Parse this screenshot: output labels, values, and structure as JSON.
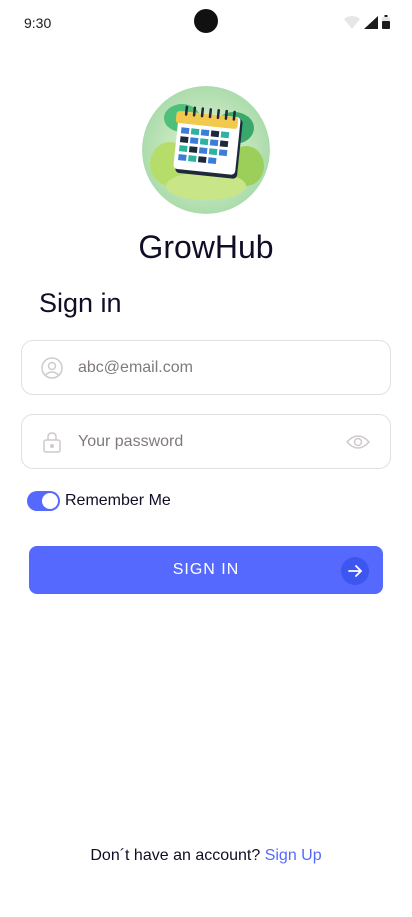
{
  "status_bar": {
    "time": "9:30"
  },
  "app": {
    "name": "GrowHub"
  },
  "form": {
    "title": "Sign in",
    "email": {
      "placeholder": "abc@email.com",
      "value": ""
    },
    "password": {
      "placeholder": "Your password",
      "value": ""
    },
    "remember_me": {
      "label": "Remember Me",
      "checked": true
    },
    "submit_label": "SIGN IN"
  },
  "footer": {
    "prompt": "Don´t have an account?",
    "link": "Sign Up"
  },
  "colors": {
    "accent": "#5669ff",
    "accent_dark": "#3d56f0",
    "text": "#120d26",
    "placeholder": "#807a7a",
    "border": "#e4dfdf"
  },
  "icons": {
    "email": "user-circle-icon",
    "password": "lock-icon",
    "visibility": "eye-icon",
    "submit": "arrow-right-icon"
  }
}
